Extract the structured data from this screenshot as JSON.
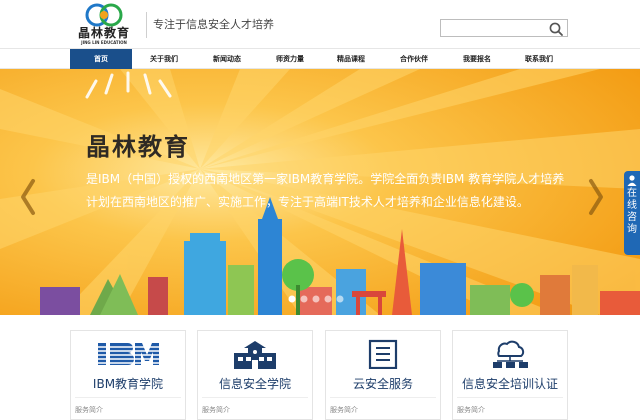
{
  "header": {
    "logo_name": "晶林教育",
    "logo_sub": "JING LIN EDUCATION",
    "slogan": "专注于信息安全人才培养",
    "search_placeholder": ""
  },
  "nav": {
    "items": [
      "首页",
      "关于我们",
      "新闻动态",
      "师资力量",
      "精品课程",
      "合作伙伴",
      "我要报名",
      "联系我们"
    ],
    "active_index": 0
  },
  "banner": {
    "title": "晶林教育",
    "text": "是IBM（中国）授权的西南地区第一家IBM教育学院。学院全面负责IBM 教育学院人才培养计划在西南地区的推广、实施工作，专注于高端IT技术人才培养和企业信息化建设。",
    "slides_total": 5,
    "slide_active": 0
  },
  "side": {
    "consult_label": "在线咨询"
  },
  "cards": [
    {
      "title": "IBM教育学院",
      "sub": "服务简介",
      "icon": "ibm-logo-icon"
    },
    {
      "title": "信息安全学院",
      "sub": "服务简介",
      "icon": "school-building-icon"
    },
    {
      "title": "云安全服务",
      "sub": "服务简介",
      "icon": "document-icon"
    },
    {
      "title": "信息安全培训认证",
      "sub": "服务简介",
      "icon": "cloud-network-icon"
    }
  ],
  "colors": {
    "brand_blue": "#1a4f8b",
    "banner_orange": "#f6a81e",
    "ibm_blue": "#1f5aa8"
  }
}
